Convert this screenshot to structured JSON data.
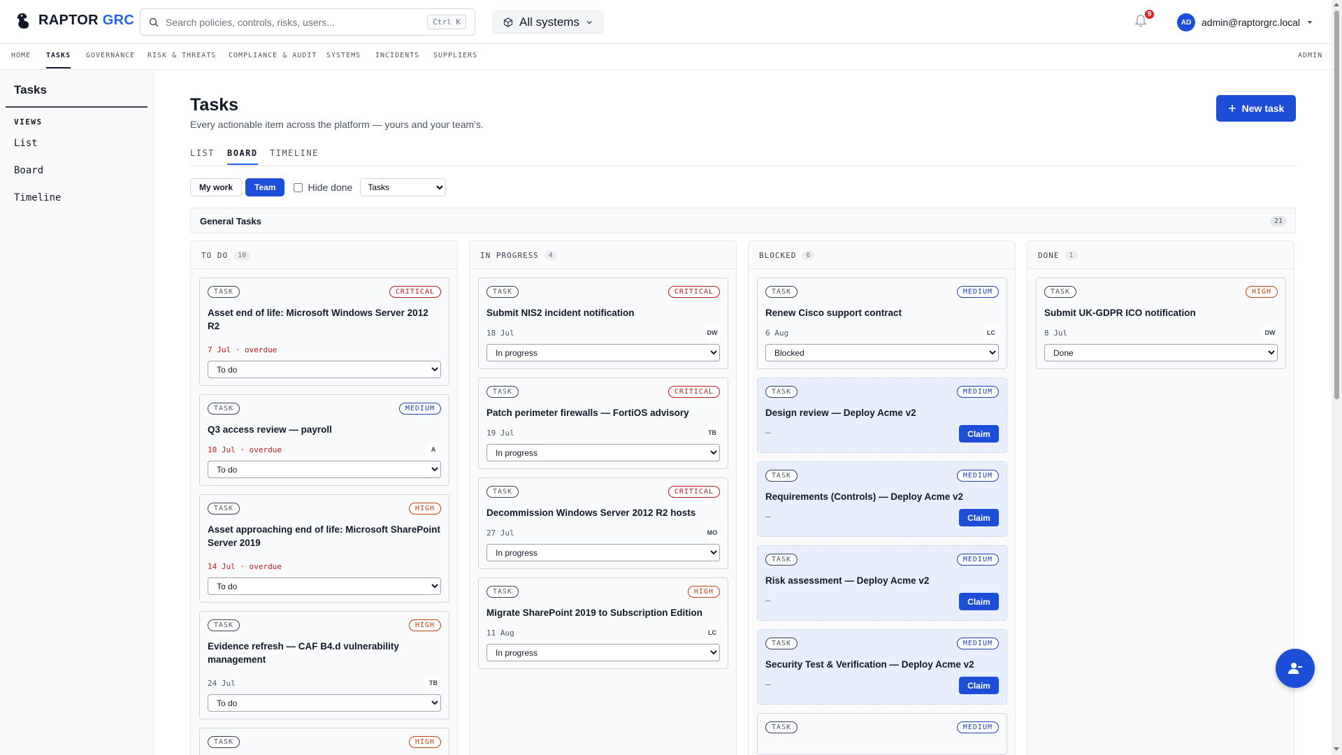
{
  "app": {
    "brand_main": "RAPTOR ",
    "brand_accent": "GRC",
    "search_placeholder": "Search policies, controls, risks, users...",
    "search_shortcut": "Ctrl K",
    "systems_label": "All systems",
    "notification_count": "9",
    "user_initials": "AD",
    "user_email": "admin@raptorgrc.local"
  },
  "nav": {
    "items": [
      "HOME",
      "TASKS",
      "GOVERNANCE",
      "RISK & THREATS",
      "COMPLIANCE & AUDIT",
      "SYSTEMS",
      "INCIDENTS",
      "SUPPLIERS"
    ],
    "active": "TASKS",
    "admin": "ADMIN"
  },
  "sidebar": {
    "title": "Tasks",
    "section": "VIEWS",
    "links": [
      "List",
      "Board",
      "Timeline"
    ]
  },
  "main": {
    "title": "Tasks",
    "subtitle": "Every actionable item across the platform — yours and your team's.",
    "new_task_label": "New task",
    "tabs": [
      "LIST",
      "BOARD",
      "TIMELINE"
    ],
    "active_tab": "BOARD",
    "filters": {
      "my_work": "My work",
      "team": "Team",
      "hide_done": "Hide done",
      "type_select": "Tasks"
    },
    "group": {
      "title": "General Tasks",
      "count": "21"
    }
  },
  "columns": [
    {
      "title": "TO DO",
      "count": "10",
      "cards": [
        {
          "type": "TASK",
          "severity": "CRITICAL",
          "title": "Asset end of life: Microsoft Windows Server 2012 R2",
          "date": "7 Jul · overdue",
          "overdue": true,
          "initials": "",
          "status": "To do"
        },
        {
          "type": "TASK",
          "severity": "MEDIUM",
          "title": "Q3 access review — payroll",
          "date": "10 Jul · overdue",
          "overdue": true,
          "initials": "A",
          "status": "To do"
        },
        {
          "type": "TASK",
          "severity": "HIGH",
          "title": "Asset approaching end of life: Microsoft SharePoint Server 2019",
          "date": "14 Jul · overdue",
          "overdue": true,
          "initials": "",
          "status": "To do"
        },
        {
          "type": "TASK",
          "severity": "HIGH",
          "title": "Evidence refresh — CAF B4.d vulnerability management",
          "date": "24 Jul",
          "overdue": false,
          "initials": "TB",
          "status": "To do"
        },
        {
          "type": "TASK",
          "severity": "HIGH",
          "title": "",
          "date": "",
          "overdue": false,
          "initials": "",
          "status": ""
        }
      ]
    },
    {
      "title": "IN PROGRESS",
      "count": "4",
      "cards": [
        {
          "type": "TASK",
          "severity": "CRITICAL",
          "title": "Submit NIS2 incident notification",
          "date": "18 Jul",
          "overdue": false,
          "initials": "DW",
          "status": "In progress"
        },
        {
          "type": "TASK",
          "severity": "CRITICAL",
          "title": "Patch perimeter firewalls — FortiOS advisory",
          "date": "19 Jul",
          "overdue": false,
          "initials": "TB",
          "status": "In progress"
        },
        {
          "type": "TASK",
          "severity": "CRITICAL",
          "title": "Decommission Windows Server 2012 R2 hosts",
          "date": "27 Jul",
          "overdue": false,
          "initials": "MO",
          "status": "In progress"
        },
        {
          "type": "TASK",
          "severity": "HIGH",
          "title": "Migrate SharePoint 2019 to Subscription Edition",
          "date": "11 Aug",
          "overdue": false,
          "initials": "LC",
          "status": "In progress"
        }
      ]
    },
    {
      "title": "BLOCKED",
      "count": "6",
      "cards": [
        {
          "type": "TASK",
          "severity": "MEDIUM",
          "title": "Renew Cisco support contract",
          "date": "6 Aug",
          "overdue": false,
          "initials": "LC",
          "status": "Blocked"
        },
        {
          "type": "TASK",
          "severity": "MEDIUM",
          "title": "Design review — Deploy Acme v2",
          "date": "–",
          "claim": "Claim"
        },
        {
          "type": "TASK",
          "severity": "MEDIUM",
          "title": "Requirements (Controls) — Deploy Acme v2",
          "date": "–",
          "claim": "Claim"
        },
        {
          "type": "TASK",
          "severity": "MEDIUM",
          "title": "Risk assessment — Deploy Acme v2",
          "date": "–",
          "claim": "Claim"
        },
        {
          "type": "TASK",
          "severity": "MEDIUM",
          "title": "Security Test & Verification — Deploy Acme v2",
          "date": "–",
          "claim": "Claim"
        },
        {
          "type": "TASK",
          "severity": "MEDIUM",
          "title": ""
        }
      ]
    },
    {
      "title": "DONE",
      "count": "1",
      "cards": [
        {
          "type": "TASK",
          "severity": "HIGH",
          "title": "Submit UK-GDPR ICO notification",
          "date": "8 Jul",
          "overdue": false,
          "initials": "DW",
          "status": "Done"
        }
      ]
    }
  ],
  "status_options": [
    "To do",
    "In progress",
    "Blocked",
    "Done"
  ],
  "icons": {
    "logo": "raptor-logo-icon",
    "search": "search-icon",
    "systems": "cube-icon",
    "notifications": "bell-icon",
    "fab": "assign-user-icon"
  }
}
